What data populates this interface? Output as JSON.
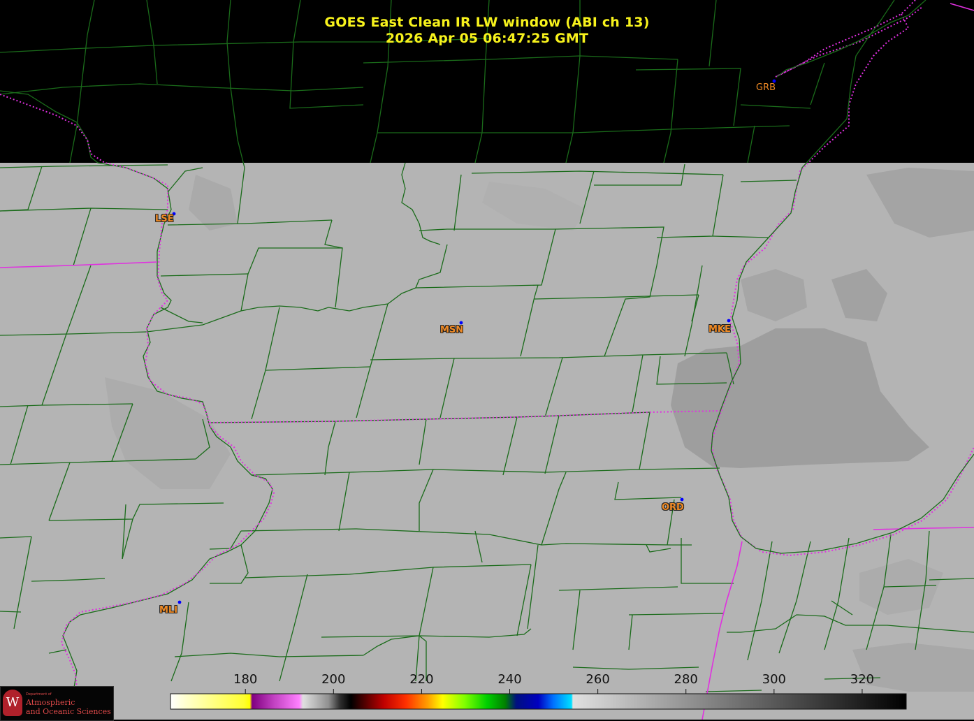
{
  "title": {
    "line1": "GOES East Clean IR LW window (ABI ch 13)",
    "line2": "2026 Apr 05  06:47:25 GMT"
  },
  "stations": [
    {
      "code": "GRB",
      "dot": true
    },
    {
      "code": "LSE",
      "dot": true
    },
    {
      "code": "MSN",
      "dot": true
    },
    {
      "code": "MKE",
      "dot": true
    },
    {
      "code": "ORD",
      "dot": true
    },
    {
      "code": "MLI",
      "dot": true
    }
  ],
  "colorbar": {
    "ticks": [
      "180",
      "200",
      "220",
      "240",
      "260",
      "280",
      "300",
      "320"
    ],
    "tick_values": [
      180,
      200,
      220,
      240,
      260,
      280,
      300,
      320
    ],
    "range": [
      163,
      330
    ]
  },
  "logo": {
    "department": "Department of",
    "line1": "Atmospheric",
    "line2": "and Oceanic Sciences",
    "seal_letter": "W"
  },
  "colors": {
    "title": "#f7f21c",
    "county_lines": "#1a6b1a",
    "state_lines": "#e030e0",
    "station_label": "#f08a24",
    "station_dot": "#0000ff",
    "no_data": "#000000",
    "cloud_free_gray": "#b4b4b4"
  }
}
